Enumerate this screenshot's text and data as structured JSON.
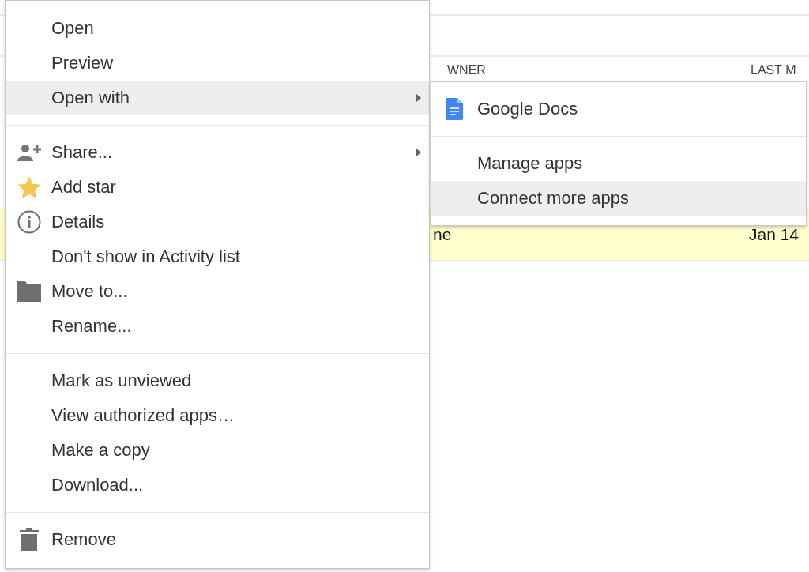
{
  "background": {
    "column_headers": [
      "WNER",
      "LAST M"
    ],
    "selected_row": {
      "cells": [
        "ne",
        "Jan 14"
      ],
      "selected": true
    }
  },
  "menu": {
    "sections": [
      [
        {
          "label": "Open",
          "selected": false,
          "has_submenu": false
        },
        {
          "label": "Preview",
          "selected": false,
          "has_submenu": false
        },
        {
          "label": "Open with",
          "selected": true,
          "has_submenu": true
        }
      ],
      [
        {
          "label": "Share...",
          "kind": "share",
          "selected": false,
          "has_submenu": true
        },
        {
          "label": "Add star",
          "kind": "star",
          "selected": false,
          "has_submenu": false
        },
        {
          "label": "Details",
          "kind": "info",
          "selected": false,
          "has_submenu": false
        },
        {
          "label": "Don't show in Activity list",
          "selected": false,
          "has_submenu": false
        },
        {
          "label": "Move to...",
          "kind": "folder",
          "selected": false,
          "has_submenu": false
        },
        {
          "label": "Rename...",
          "selected": false,
          "has_submenu": false
        }
      ],
      [
        {
          "label": "Mark as unviewed",
          "selected": false,
          "has_submenu": false
        },
        {
          "label": "View authorized apps…",
          "selected": false,
          "has_submenu": false
        },
        {
          "label": "Make a copy",
          "selected": false,
          "has_submenu": false
        },
        {
          "label": "Download...",
          "selected": false,
          "has_submenu": false
        }
      ],
      [
        {
          "label": "Remove",
          "kind": "trash",
          "selected": false,
          "has_submenu": false
        }
      ]
    ]
  },
  "submenu": {
    "sections": [
      [
        {
          "label": "Google Docs",
          "kind": "docs",
          "selected": false
        }
      ],
      [
        {
          "label": "Manage apps",
          "selected": false
        },
        {
          "label": "Connect more apps",
          "selected": true
        }
      ]
    ]
  }
}
